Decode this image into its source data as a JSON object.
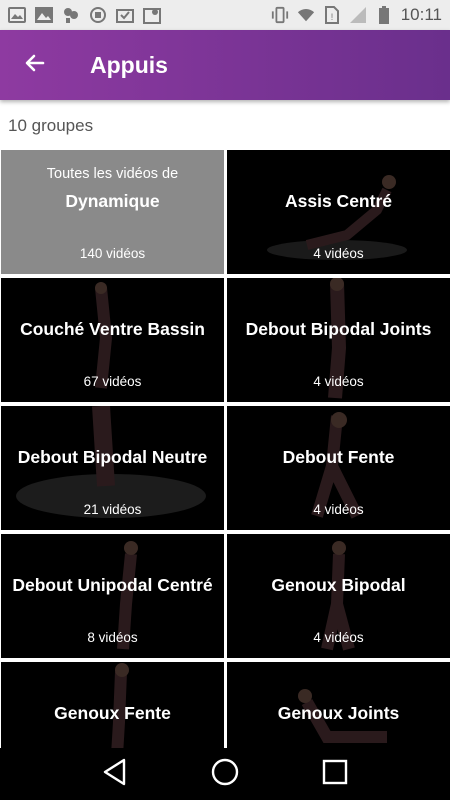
{
  "status": {
    "time": "10:11",
    "left_icons": [
      "image-icon",
      "gallery-icon",
      "app-icon",
      "sync-icon",
      "inbox-check-icon",
      "map-icon"
    ],
    "right_icons": [
      "vibrate-icon",
      "wifi-icon",
      "no-sim-icon",
      "signal-icon",
      "battery-icon"
    ]
  },
  "appbar": {
    "title": "Appuis",
    "back_icon": "arrow-left-icon"
  },
  "count_label": "10 groupes",
  "tiles": [
    {
      "pre": "Toutes les vidéos de",
      "name": "Dynamique",
      "count": "140 vidéos"
    },
    {
      "name": "Assis Centré",
      "count": "4 vidéos"
    },
    {
      "name": "Couché Ventre Bassin",
      "count": "67 vidéos"
    },
    {
      "name": "Debout Bipodal Joints",
      "count": "4 vidéos"
    },
    {
      "name": "Debout Bipodal Neutre",
      "count": "21 vidéos"
    },
    {
      "name": "Debout Fente",
      "count": "4 vidéos"
    },
    {
      "name": "Debout Unipodal Centré",
      "count": "8 vidéos"
    },
    {
      "name": "Genoux Bipodal",
      "count": "4 vidéos"
    },
    {
      "name": "Genoux Fente",
      "count": ""
    },
    {
      "name": "Genoux Joints",
      "count": ""
    }
  ],
  "navbar": {
    "back": "back-triangle-icon",
    "home": "home-circle-icon",
    "recents": "recents-square-icon"
  }
}
